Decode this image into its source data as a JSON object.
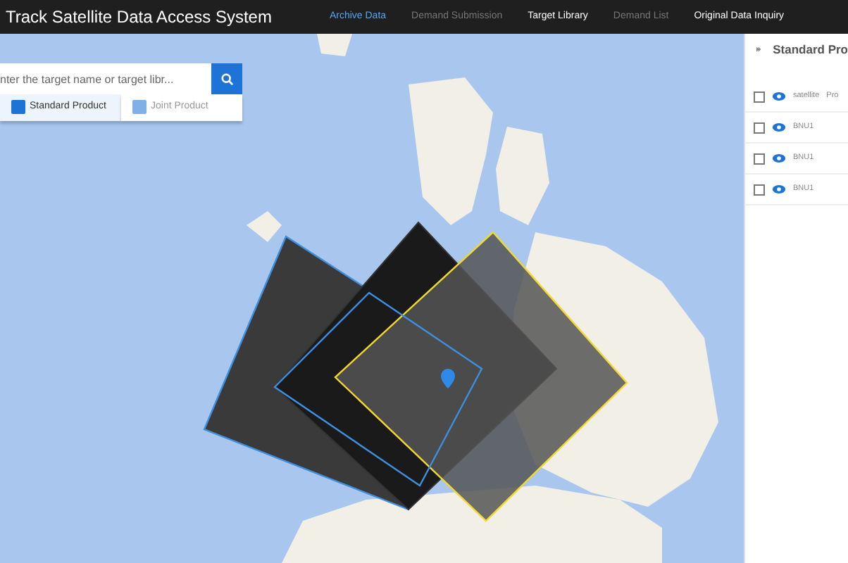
{
  "app_title": "Track Satellite Data Access System",
  "nav": [
    {
      "label": "Archive Data",
      "selected": true,
      "disabled": false
    },
    {
      "label": "Demand Submission",
      "selected": false,
      "disabled": true
    },
    {
      "label": "Target Library",
      "selected": false,
      "disabled": false
    },
    {
      "label": "Demand List",
      "selected": false,
      "disabled": true
    },
    {
      "label": "Original Data Inquiry",
      "selected": false,
      "disabled": false
    }
  ],
  "search": {
    "placeholder": "nter the target name or target libr..."
  },
  "product_tabs": [
    {
      "label": "Standard Product",
      "selected": true
    },
    {
      "label": "Joint Product",
      "selected": false
    }
  ],
  "panel": {
    "title": "Standard Pro",
    "header_checked": false,
    "columns": [
      "satellite",
      "Pro"
    ],
    "rows": [
      {
        "satellite": "BNU1",
        "checked": false
      },
      {
        "satellite": "BNU1",
        "checked": false
      },
      {
        "satellite": "BNU1",
        "checked": false
      }
    ]
  }
}
